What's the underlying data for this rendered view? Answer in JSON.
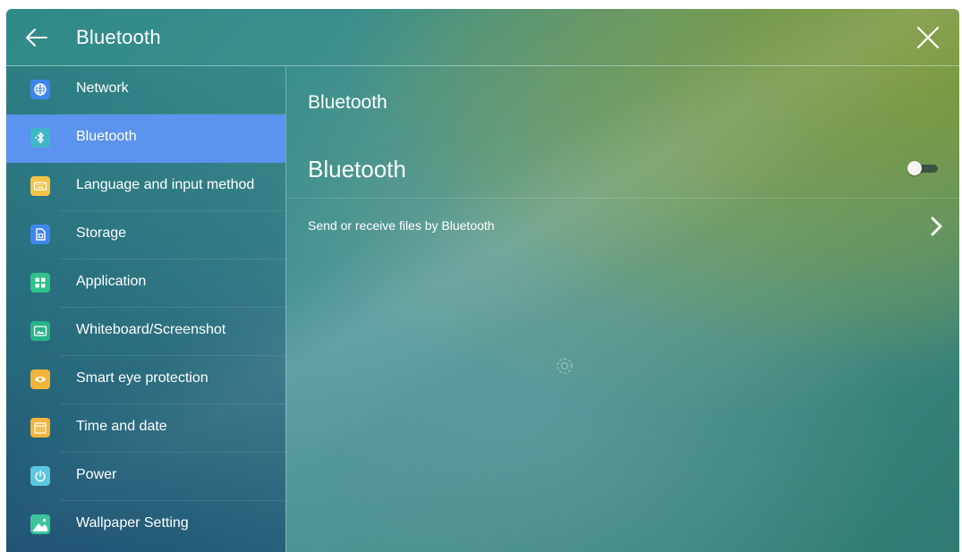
{
  "window": {
    "title": "Bluetooth",
    "back_icon": "arrow-left-icon",
    "close_icon": "close-icon"
  },
  "sidebar": {
    "items": [
      {
        "label": "Network",
        "icon": "globe-icon",
        "color": "#3f86f0",
        "active": false
      },
      {
        "label": "Bluetooth",
        "icon": "bluetooth-icon",
        "color": "#3fb7c9",
        "active": true
      },
      {
        "label": "Language and input method",
        "icon": "keyboard-icon",
        "color": "#f3c34a",
        "active": false
      },
      {
        "label": "Storage",
        "icon": "storage-icon",
        "color": "#3f86f0",
        "active": false
      },
      {
        "label": "Application",
        "icon": "apps-grid-icon",
        "color": "#2fc28a",
        "active": false
      },
      {
        "label": "Whiteboard/Screenshot",
        "icon": "screenshot-icon",
        "color": "#27b487",
        "active": false
      },
      {
        "label": "Smart eye protection",
        "icon": "eye-icon",
        "color": "#f2b43c",
        "active": false
      },
      {
        "label": "Time and date",
        "icon": "calendar-icon",
        "color": "#f2b43c",
        "active": false
      },
      {
        "label": "Power",
        "icon": "power-icon",
        "color": "#5cc6e0",
        "active": false
      },
      {
        "label": "Wallpaper Setting",
        "icon": "image-icon",
        "color": "#3cc39a",
        "active": false
      }
    ]
  },
  "content": {
    "section_title": "Bluetooth",
    "bluetooth_toggle": {
      "label": "Bluetooth",
      "enabled": false
    },
    "send_receive": {
      "label": "Send or receive files by Bluetooth",
      "icon": "chevron-right-icon"
    },
    "loading_icon": "loading-spinner-icon"
  },
  "colors": {
    "active_item": "#5b93ee",
    "text": "#ffffff"
  }
}
